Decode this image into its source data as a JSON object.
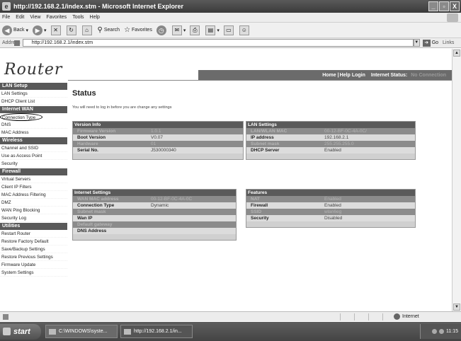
{
  "window": {
    "title": "http://192.168.2.1/index.stm - Microsoft Internet Explorer",
    "minimize": "_",
    "maximize": "▫",
    "close": "X"
  },
  "menu": [
    "File",
    "Edit",
    "View",
    "Favorites",
    "Tools",
    "Help"
  ],
  "toolbar": {
    "back": "Back",
    "search": "Search",
    "favorites": "Favorites"
  },
  "address": {
    "label": "Address",
    "url": "http://192.168.2.1/index.stm",
    "go": "Go",
    "links": "Links"
  },
  "page": {
    "logo": "Router",
    "nav": {
      "home": "Home",
      "sep": "|",
      "help": "Help",
      "login": "Login",
      "internet_status_label": "Internet Status:",
      "internet_status_value": "No Connection"
    },
    "status_title": "Status",
    "notice": "You will need to log in before you are change any settings"
  },
  "sidebar": {
    "sections": [
      {
        "title": "LAN Setup",
        "items": [
          "LAN Settings",
          "DHCP Client List"
        ]
      },
      {
        "title": "Internet WAN",
        "items": [
          "Connection Type",
          "DNS",
          "MAC Address"
        ]
      },
      {
        "title": "Wireless",
        "items": [
          "Channel and SSID",
          "Use as Access Point",
          "Security"
        ]
      },
      {
        "title": "Firewall",
        "items": [
          "Virtual Servers",
          "Client IP Filters",
          "MAC Address Filtering",
          "DMZ",
          "WAN Ping Blocking",
          "Security Log"
        ]
      },
      {
        "title": "Utilities",
        "items": [
          "Restart Router",
          "Restore Factory Default",
          "Save/Backup Settings",
          "Restore Previous Settings",
          "Firmware Update",
          "System Settings"
        ]
      }
    ]
  },
  "panels": {
    "version_info": {
      "title": "Version Info",
      "rows": [
        {
          "k": "Firmware Version",
          "v": "1.0.1"
        },
        {
          "k": "Boot Version",
          "v": "V0.07"
        },
        {
          "k": "Hardware",
          "v": "01"
        },
        {
          "k": "Serial No.",
          "v": "J530000340"
        }
      ]
    },
    "lan_settings": {
      "title": "LAN Settings",
      "rows": [
        {
          "k": "LAN/WLAN MAC",
          "v": "00-12-BF-0C-4A-0C/"
        },
        {
          "k": "IP address",
          "v": "192.168.2.1"
        },
        {
          "k": "Subnet mask",
          "v": "255.255.255.0"
        },
        {
          "k": "DHCP Server",
          "v": "Enabled"
        }
      ]
    },
    "internet_settings": {
      "title": "Internet Settings",
      "rows": [
        {
          "k": "WAN MAC address",
          "v": "00-12-BF-0C-4A-0C"
        },
        {
          "k": "Connection Type",
          "v": "Dynamic"
        },
        {
          "k": "Subnet mask",
          "v": ""
        },
        {
          "k": "Wan IP",
          "v": ""
        },
        {
          "k": "Default gateway",
          "v": ""
        },
        {
          "k": "DNS Address",
          "v": ""
        }
      ]
    },
    "features": {
      "title": "Features",
      "rows": [
        {
          "k": "NAT",
          "v": "Enabled"
        },
        {
          "k": "Firewall",
          "v": "Enabled"
        },
        {
          "k": "SSID",
          "v": "wlan6eg"
        },
        {
          "k": "Security",
          "v": "Disabled"
        }
      ]
    }
  },
  "statusbar": {
    "zone": "Internet"
  },
  "taskbar": {
    "start": "start",
    "tasks": [
      "C:\\WINDOWS\\syste...",
      "http://192.168.2.1/in..."
    ],
    "clock": "11:15"
  }
}
